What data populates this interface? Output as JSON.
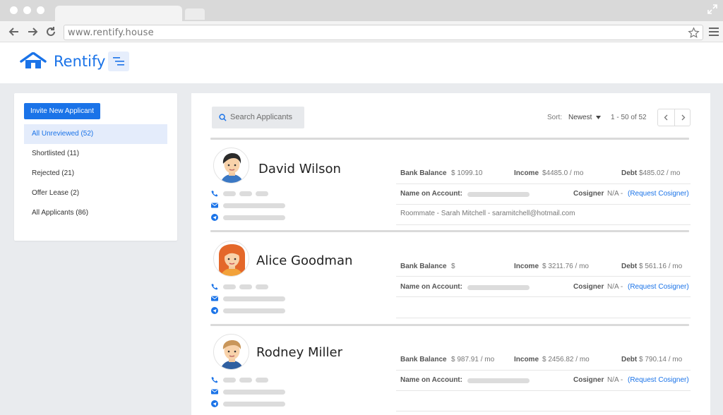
{
  "browser": {
    "url": "www.rentify.house"
  },
  "app": {
    "brand": "Rentify"
  },
  "sidebar": {
    "invite_label": "Invite New Applicant",
    "items": [
      {
        "label": "All Unreviewed (52)"
      },
      {
        "label": "Shortlisted (11)"
      },
      {
        "label": "Rejected (21)"
      },
      {
        "label": "Offer Lease (2)"
      },
      {
        "label": "All Applicants (86)"
      }
    ]
  },
  "toolbar": {
    "search_placeholder": "Search Applicants",
    "sort_label": "Sort:",
    "sort_value": "Newest",
    "page_range": "1 - 50 of 52"
  },
  "labels": {
    "bank_balance": "Bank Balance",
    "income": "Income",
    "debt": "Debt",
    "name_on_account": "Name on Account:",
    "cosigner": "Cosigner",
    "request_cosigner": "(Request Cosigner)"
  },
  "applicants": [
    {
      "name": "David Wilson",
      "bank_balance": "$ 1099.10",
      "income": "$4485.0 / mo",
      "debt": "$485.02 / mo",
      "cosigner": "N/A -",
      "roommate": "Roommate - Sarah Mitchell - saramitchell@hotmail.com"
    },
    {
      "name": "Alice Goodman",
      "bank_balance": "$",
      "income": "$ 3211.76 / mo",
      "debt": "$ 561.16 / mo",
      "cosigner": "N/A -"
    },
    {
      "name": "Rodney Miller",
      "bank_balance": "$ 987.91 / mo",
      "income": "$ 2456.82 / mo",
      "debt": "$ 790.14 / mo",
      "cosigner": "N/A -"
    }
  ],
  "colors": {
    "accent": "#1a73e8",
    "sidebar_active_bg": "#e4ecfb"
  }
}
